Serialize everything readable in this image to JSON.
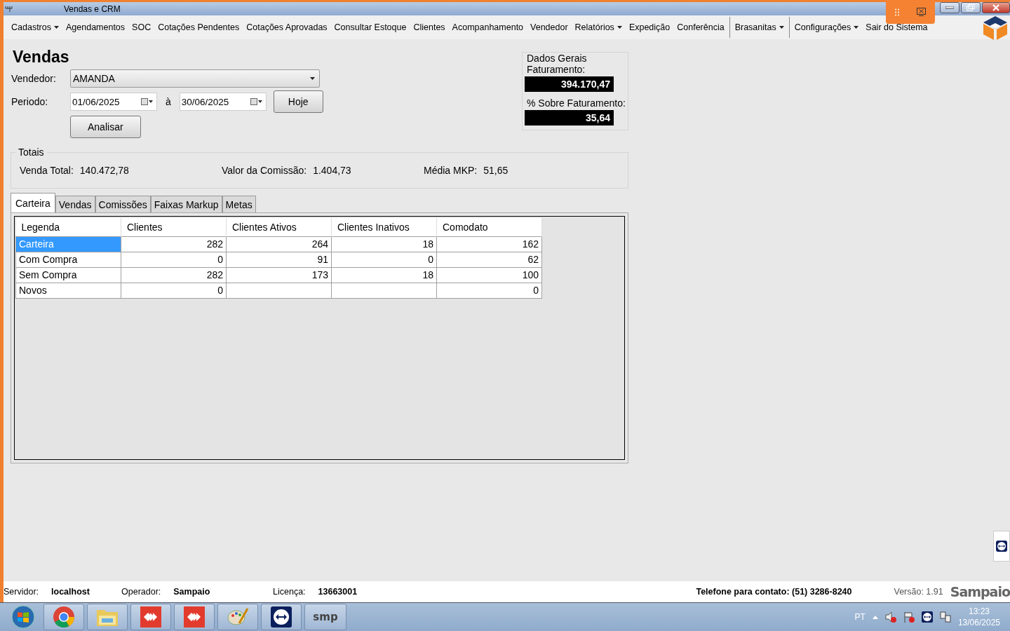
{
  "window": {
    "title": "Vendas e CRM"
  },
  "menu_groups": [
    [
      {
        "label": "Cadastros",
        "dropdown": true
      },
      {
        "label": "Agendamentos",
        "dropdown": false
      },
      {
        "label": "SOC",
        "dropdown": false
      },
      {
        "label": "Cotações Pendentes",
        "dropdown": false
      },
      {
        "label": "Cotações Aprovadas",
        "dropdown": false
      },
      {
        "label": "Consultar Estoque",
        "dropdown": false
      },
      {
        "label": "Clientes",
        "dropdown": false
      },
      {
        "label": "Acompanhamento",
        "dropdown": false
      },
      {
        "label": "Vendedor",
        "dropdown": false
      },
      {
        "label": "Relatórios",
        "dropdown": true
      },
      {
        "label": "Expedição",
        "dropdown": false
      },
      {
        "label": "Conferência",
        "dropdown": false
      }
    ],
    [
      {
        "label": "Brasanitas",
        "dropdown": true
      }
    ],
    [
      {
        "label": "Configurações",
        "dropdown": true
      },
      {
        "label": "Sair do Sistema",
        "dropdown": false
      }
    ]
  ],
  "page_title": "Vendas",
  "vendedor": {
    "label": "Vendedor:",
    "value": "AMANDA"
  },
  "periodo": {
    "label": "Periodo:",
    "from": "01/06/2025",
    "between": "à",
    "to": "30/06/2025"
  },
  "buttons": {
    "today": "Hoje",
    "analyze": "Analisar"
  },
  "dados_gerais": {
    "title": "Dados Gerais",
    "fields": [
      {
        "label": "Faturamento:",
        "value": "394.170,47"
      },
      {
        "label": "% Sobre Faturamento:",
        "value": "35,64"
      }
    ]
  },
  "totais": {
    "title": "Totais",
    "items": [
      {
        "label": "Venda Total:",
        "value": "140.472,78"
      },
      {
        "label": "Valor da Comissão:",
        "value": "1.404,73"
      },
      {
        "label": "Média MKP:",
        "value": "51,65"
      }
    ]
  },
  "tabs": [
    {
      "label": "Carteira",
      "selected": true
    },
    {
      "label": "Vendas",
      "selected": false
    },
    {
      "label": "Comissões",
      "selected": false
    },
    {
      "label": "Faixas Markup",
      "selected": false
    },
    {
      "label": "Metas",
      "selected": false
    }
  ],
  "table": {
    "columns": [
      "Legenda",
      "Clientes",
      "Clientes Ativos",
      "Clientes Inativos",
      "Comodato"
    ],
    "rows": [
      {
        "cells": [
          "Carteira",
          "282",
          "264",
          "18",
          "162"
        ],
        "selected": true
      },
      {
        "cells": [
          "Com Compra",
          "0",
          "91",
          "0",
          "62"
        ],
        "selected": false
      },
      {
        "cells": [
          "Sem Compra",
          "282",
          "173",
          "18",
          "100"
        ],
        "selected": false
      },
      {
        "cells": [
          "Novos",
          "0",
          null,
          null,
          "0"
        ],
        "selected": false
      }
    ]
  },
  "status_bar": {
    "items": [
      {
        "label": "Servidor:",
        "value": "localhost"
      },
      {
        "label": "Operador:",
        "value": "Sampaio"
      },
      {
        "label": "Licença:",
        "value": "13663001"
      }
    ],
    "phone": "Telefone para contato: (51) 3286-8240",
    "version": "Versão: 1.91",
    "logo": "Sampaio"
  },
  "taskbar": {
    "apps": [
      {
        "kind": "chrome"
      },
      {
        "kind": "folder"
      },
      {
        "kind": "anydesk"
      },
      {
        "kind": "anydesk"
      },
      {
        "kind": "paint"
      },
      {
        "kind": "teamviewer"
      },
      {
        "kind": "smp",
        "label": "smp"
      }
    ],
    "language": "PT",
    "time": "13:23",
    "date": "13/06/2025"
  }
}
